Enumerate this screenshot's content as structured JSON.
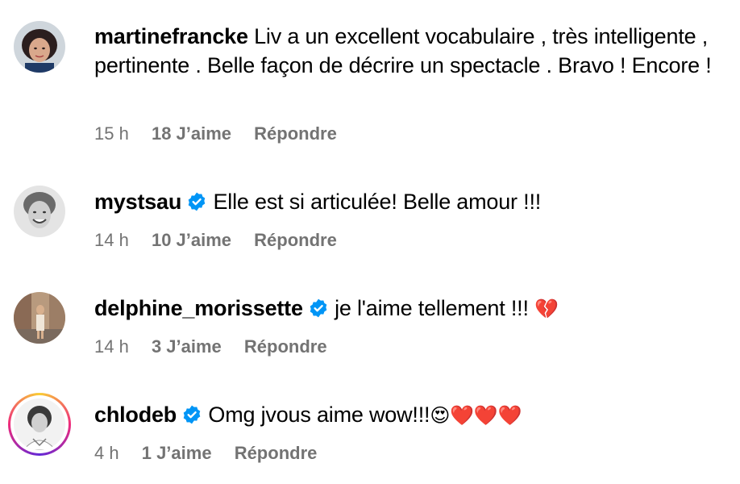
{
  "comments": [
    {
      "username": "martinefrancke",
      "verified": false,
      "text": "Liv a un excellent vocabulaire , très intelligente , pertinente . Belle façon de décrire un spectacle . Bravo ! Encore !",
      "time": "15 h",
      "likes": "18 J’aime",
      "reply": "Répondre"
    },
    {
      "username": "mystsau",
      "verified": true,
      "text": "Elle est si articulée! Belle amour !!!",
      "time": "14 h",
      "likes": "10 J’aime",
      "reply": "Répondre"
    },
    {
      "username": "delphine_morissette",
      "verified": true,
      "text": "je l'aime tellement !!!",
      "emoji": "💔",
      "time": "14 h",
      "likes": "3 J’aime",
      "reply": "Répondre"
    },
    {
      "username": "chlodeb",
      "verified": true,
      "text": "Omg jvous aime wow!!!",
      "emoji": "😍❤️❤️❤️",
      "time": "4 h",
      "likes": "1 J’aime",
      "reply": "Répondre"
    }
  ],
  "colors": {
    "meta_text": "#737373",
    "verified_badge": "#0095f6",
    "story_ring": "#ee2a7b"
  }
}
